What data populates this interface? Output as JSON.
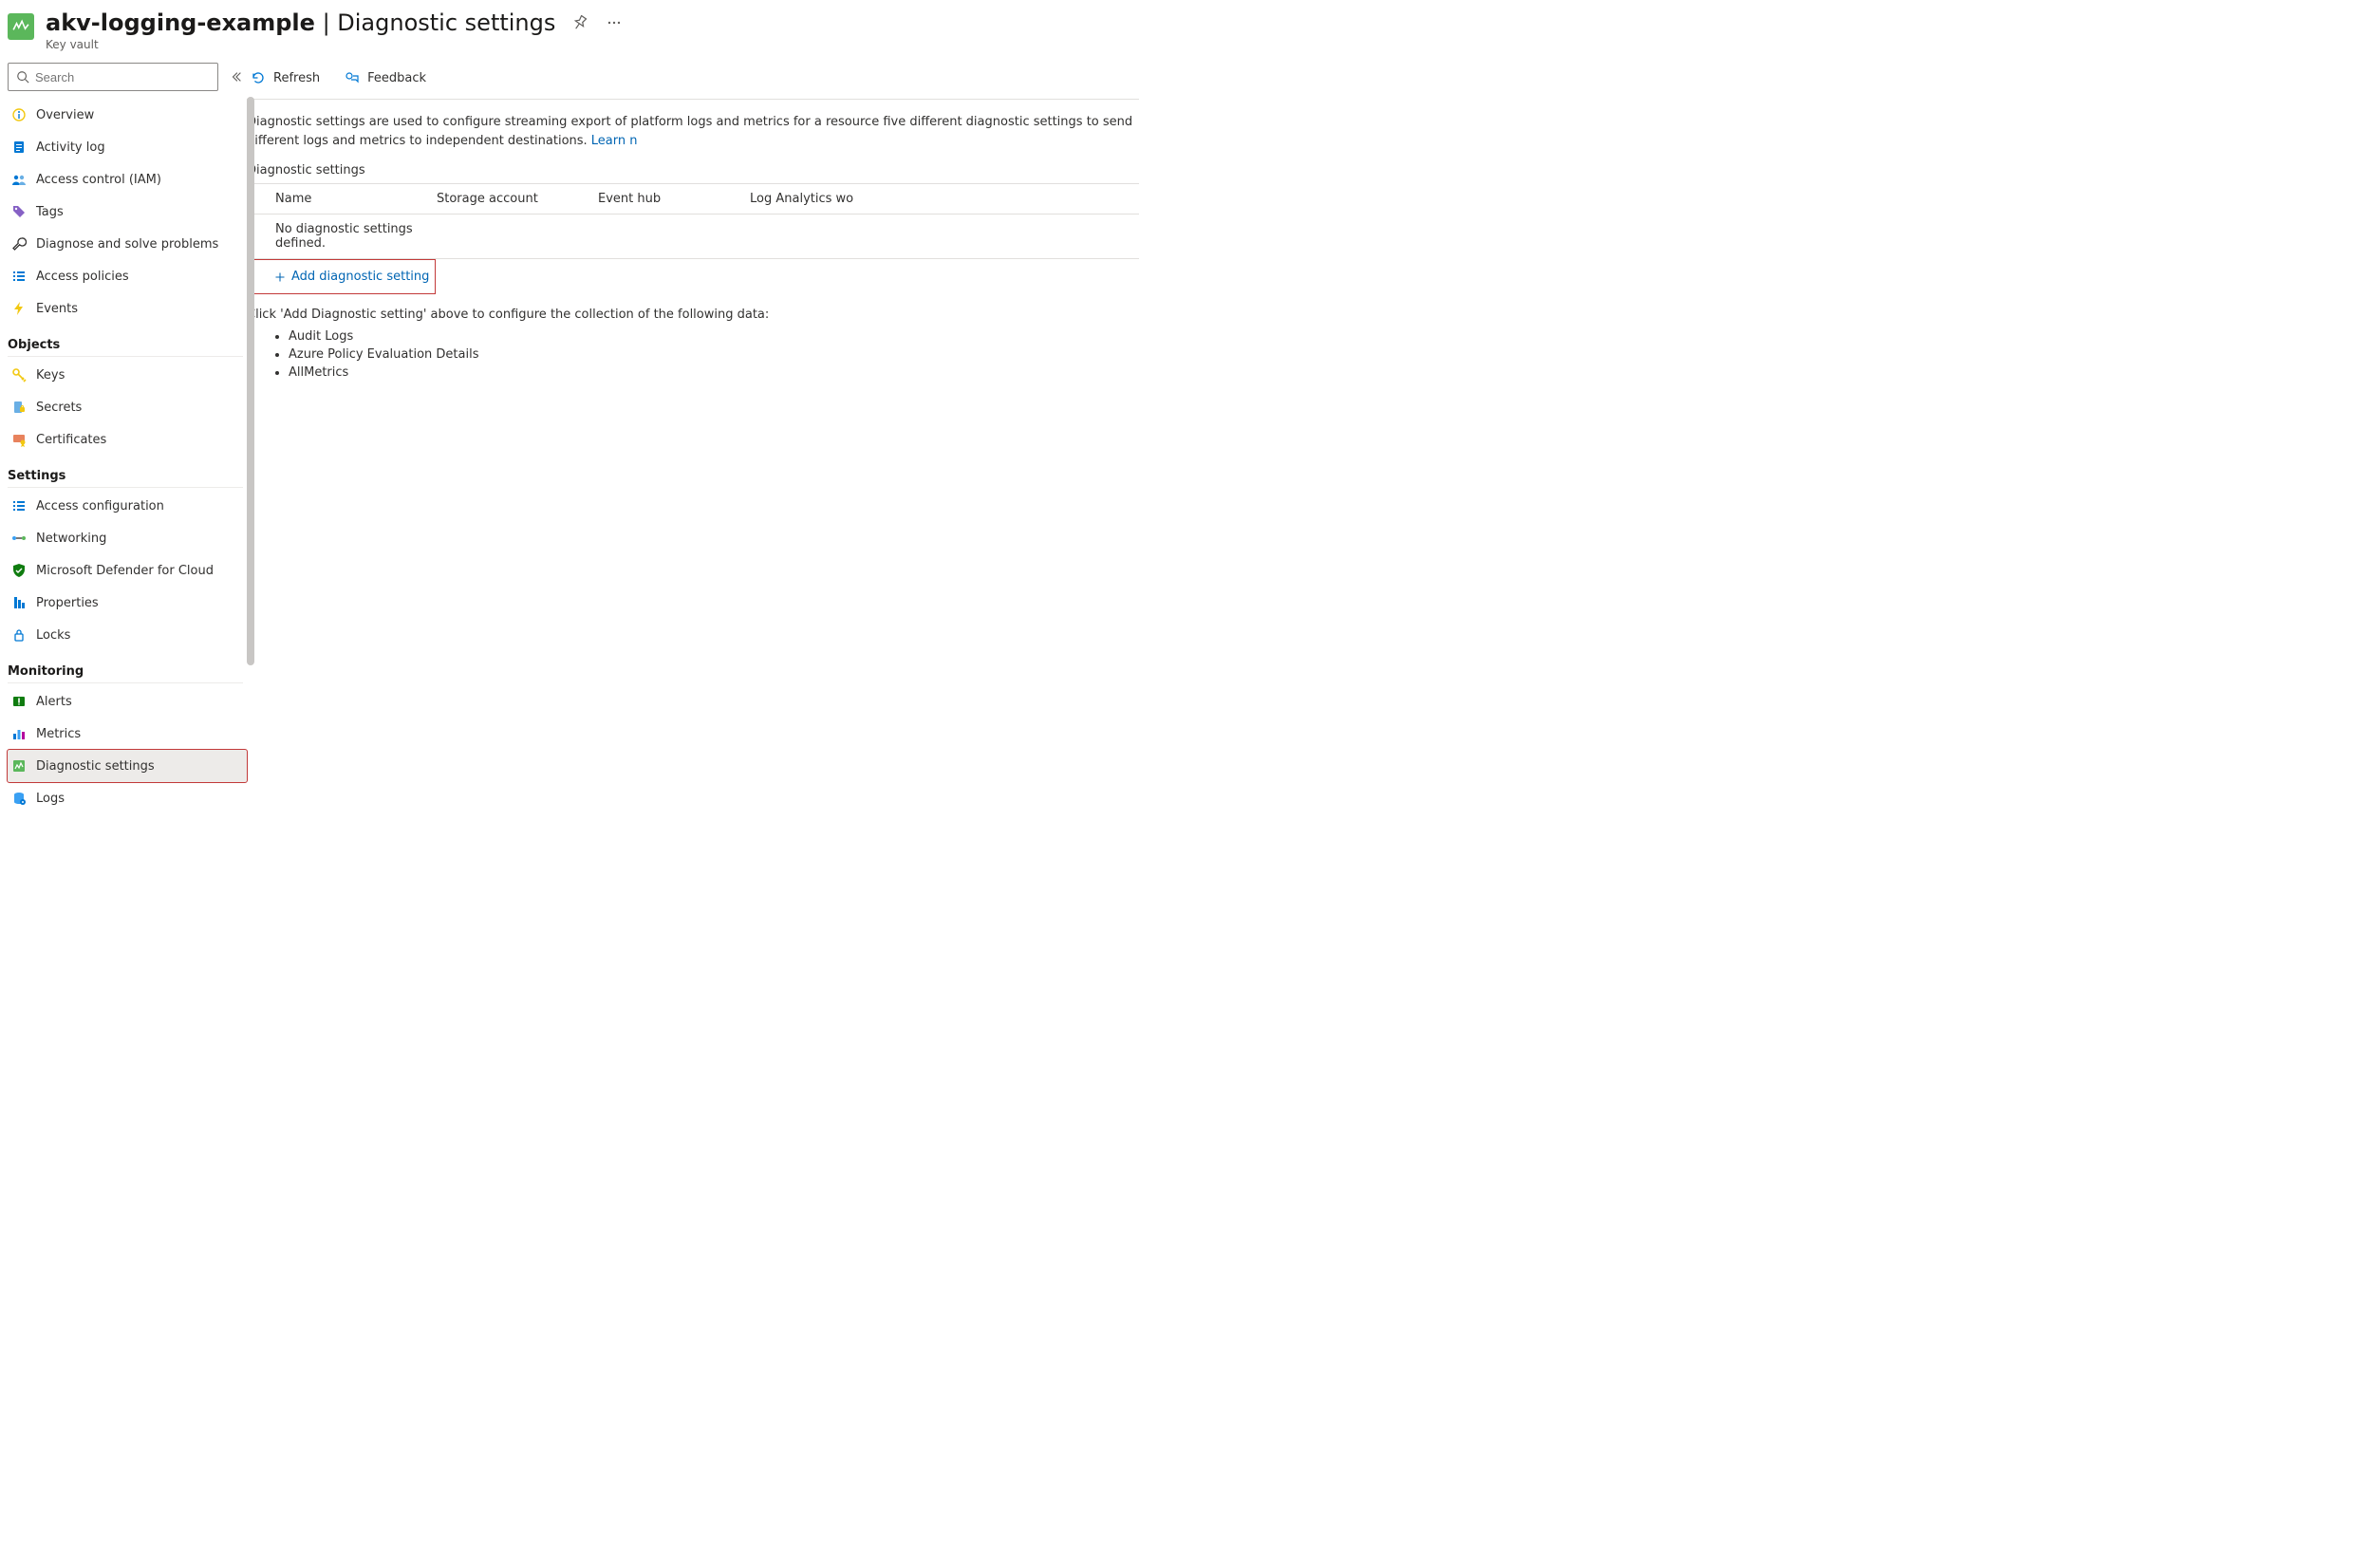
{
  "header": {
    "resource_name": "akv-logging-example",
    "separator": " | ",
    "blade": "Diagnostic settings",
    "resource_type": "Key vault"
  },
  "sidebar": {
    "search_placeholder": "Search",
    "top": [
      {
        "label": "Overview",
        "icon": "globe-info"
      },
      {
        "label": "Activity log",
        "icon": "log-blue"
      },
      {
        "label": "Access control (IAM)",
        "icon": "people-blue"
      },
      {
        "label": "Tags",
        "icon": "tag-purple"
      },
      {
        "label": "Diagnose and solve problems",
        "icon": "wrench"
      },
      {
        "label": "Access policies",
        "icon": "list-blue"
      },
      {
        "label": "Events",
        "icon": "bolt-yellow"
      }
    ],
    "groups": [
      {
        "title": "Objects",
        "items": [
          {
            "label": "Keys",
            "icon": "key-yellow"
          },
          {
            "label": "Secrets",
            "icon": "secret"
          },
          {
            "label": "Certificates",
            "icon": "cert"
          }
        ]
      },
      {
        "title": "Settings",
        "items": [
          {
            "label": "Access configuration",
            "icon": "list-blue"
          },
          {
            "label": "Networking",
            "icon": "network"
          },
          {
            "label": "Microsoft Defender for Cloud",
            "icon": "shield-green"
          },
          {
            "label": "Properties",
            "icon": "props-blue"
          },
          {
            "label": "Locks",
            "icon": "lock-blue"
          }
        ]
      },
      {
        "title": "Monitoring",
        "items": [
          {
            "label": "Alerts",
            "icon": "alert-green"
          },
          {
            "label": "Metrics",
            "icon": "bars-blue"
          },
          {
            "label": "Diagnostic settings",
            "icon": "diag-green",
            "selected": true
          },
          {
            "label": "Logs",
            "icon": "logs-blue"
          }
        ]
      }
    ]
  },
  "commands": {
    "refresh": "Refresh",
    "feedback": "Feedback"
  },
  "description": {
    "text": "Diagnostic settings are used to configure streaming export of platform logs and metrics for a resource five different diagnostic settings to send different logs and metrics to independent destinations. ",
    "learn_label": "Learn n"
  },
  "section_label": "Diagnostic settings",
  "table": {
    "cols": [
      "Name",
      "Storage account",
      "Event hub",
      "Log Analytics wo"
    ],
    "empty_row": "No diagnostic settings defined.",
    "add_label": "Add diagnostic setting"
  },
  "instruction": {
    "text": "Click 'Add Diagnostic setting' above to configure the collection of the following data:",
    "items": [
      "Audit Logs",
      "Azure Policy Evaluation Details",
      "AllMetrics"
    ]
  }
}
